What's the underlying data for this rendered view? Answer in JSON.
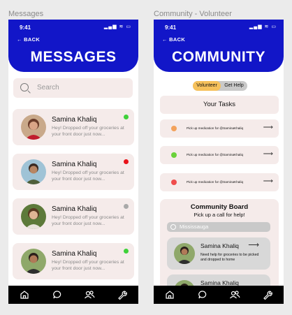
{
  "frames": {
    "messages_label": "Messages",
    "community_label": "Community - Volunteer"
  },
  "status_bar": {
    "time": "9:41",
    "icons": "▂▄▆ ≋ ▭"
  },
  "messages": {
    "back_label": "← BACK",
    "title": "MESSAGES",
    "search_placeholder": "Search",
    "conversations": [
      {
        "name": "Samina Khaliq",
        "preview": "Hey! Dropped off your groceries at your front door just now...",
        "status_color": "#3fd13a"
      },
      {
        "name": "Samina Khaliq",
        "preview": "Hey! Dropped off your groceries at your front door just now...",
        "status_color": "#e8121a"
      },
      {
        "name": "Samina Khaliq",
        "preview": "Hey! Dropped off your groceries at your front door just now...",
        "status_color": "#a9a9a9"
      },
      {
        "name": "Samina Khaliq",
        "preview": "Hey! Dropped off your groceries at your front door just now...",
        "status_color": "#3fd13a"
      }
    ]
  },
  "community": {
    "back_label": "← BACK",
    "title": "COMMUNITY",
    "toggle": {
      "volunteer": "Volunteer",
      "get_help": "Get Help",
      "active": "Volunteer"
    },
    "tasks_title": "Your Tasks",
    "tasks": [
      {
        "text": "Pick up medication for @SaminaKhaliq",
        "dot_color": "#f3a25c",
        "arrow": "⟶"
      },
      {
        "text": "Pick up medication for @SaminaKhaliq",
        "dot_color": "#6ad23a",
        "arrow": "⟶"
      },
      {
        "text": "Pick up medication for @SaminaKhaliq",
        "dot_color": "#ef4d4d",
        "arrow": "⟶"
      }
    ],
    "board": {
      "title": "Community Board",
      "subtitle": "Pick up a call for help!",
      "search_value": "Mississauga",
      "posts": [
        {
          "name": "Samina Khaliq",
          "text": "Need help for groceries to be picked and dropped to home",
          "arrow": "⟶"
        },
        {
          "name": "Samina Khaliq",
          "text": "",
          "arrow": ""
        }
      ]
    }
  },
  "nav": {
    "items": [
      "home-icon",
      "chat-bubble-icon",
      "people-icon",
      "wrench-icon"
    ]
  },
  "colors": {
    "header_blue": "#1216c8",
    "card_bg": "#f5ebea",
    "toggle_active": "#f6c15b",
    "navbar": "#000000"
  }
}
